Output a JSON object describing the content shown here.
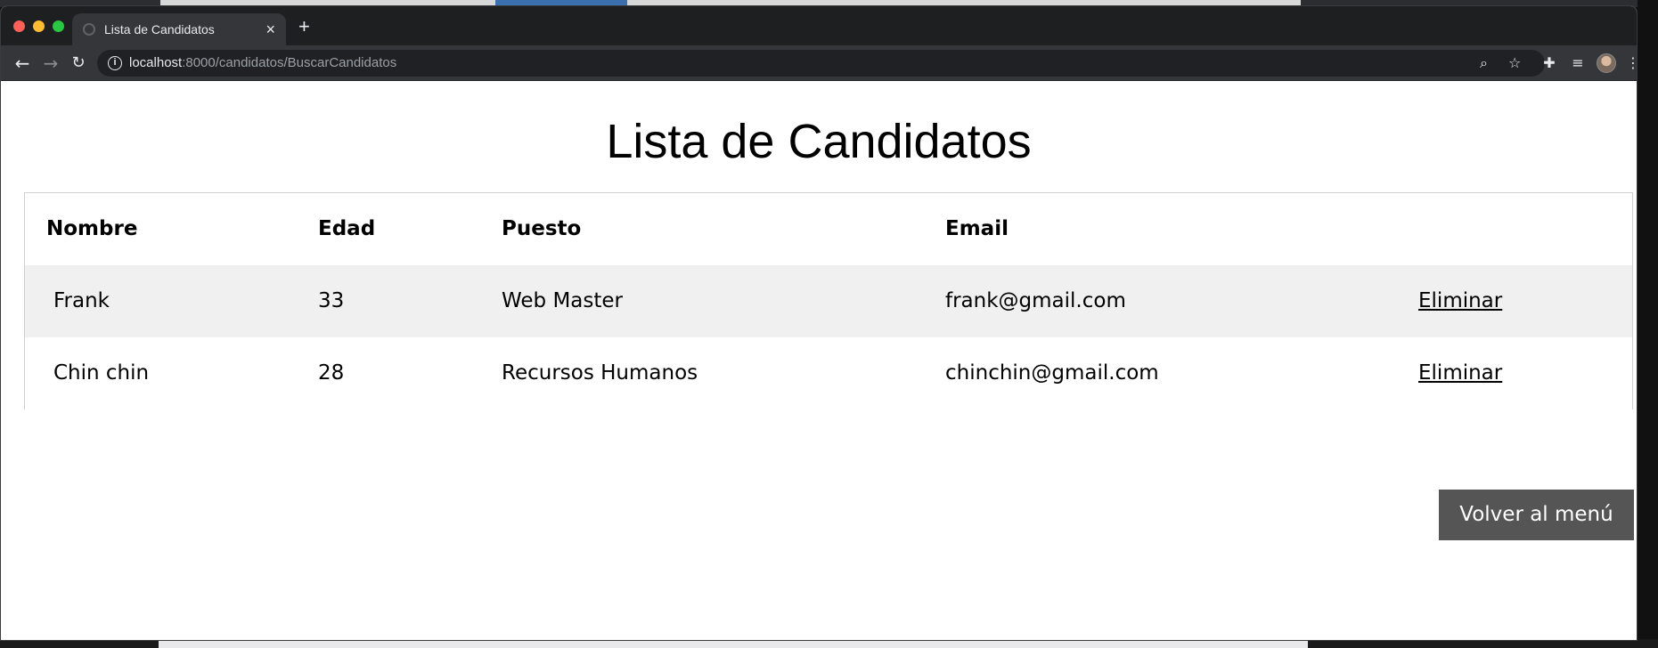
{
  "browser": {
    "tab_title": "Lista de Candidatos",
    "tab_close": "×",
    "new_tab": "+",
    "url_host": "localhost",
    "url_rest": ":8000/candidatos/BuscarCandidatos"
  },
  "page": {
    "title": "Lista de Candidatos",
    "table": {
      "headers": [
        "Nombre",
        "Edad",
        "Puesto",
        "Email"
      ],
      "rows": [
        {
          "nombre": "Frank",
          "edad": "33",
          "puesto": "Web Master",
          "email": "frank@gmail.com",
          "action": "Eliminar"
        },
        {
          "nombre": "Chin chin",
          "edad": "28",
          "puesto": "Recursos Humanos",
          "email": "chinchin@gmail.com",
          "action": "Eliminar"
        }
      ]
    },
    "back_button": "Volver al menú"
  },
  "colors": {
    "button_bg": "#555555",
    "stripe_row": "#f0f0f0",
    "browser_chrome": "#35363a"
  }
}
